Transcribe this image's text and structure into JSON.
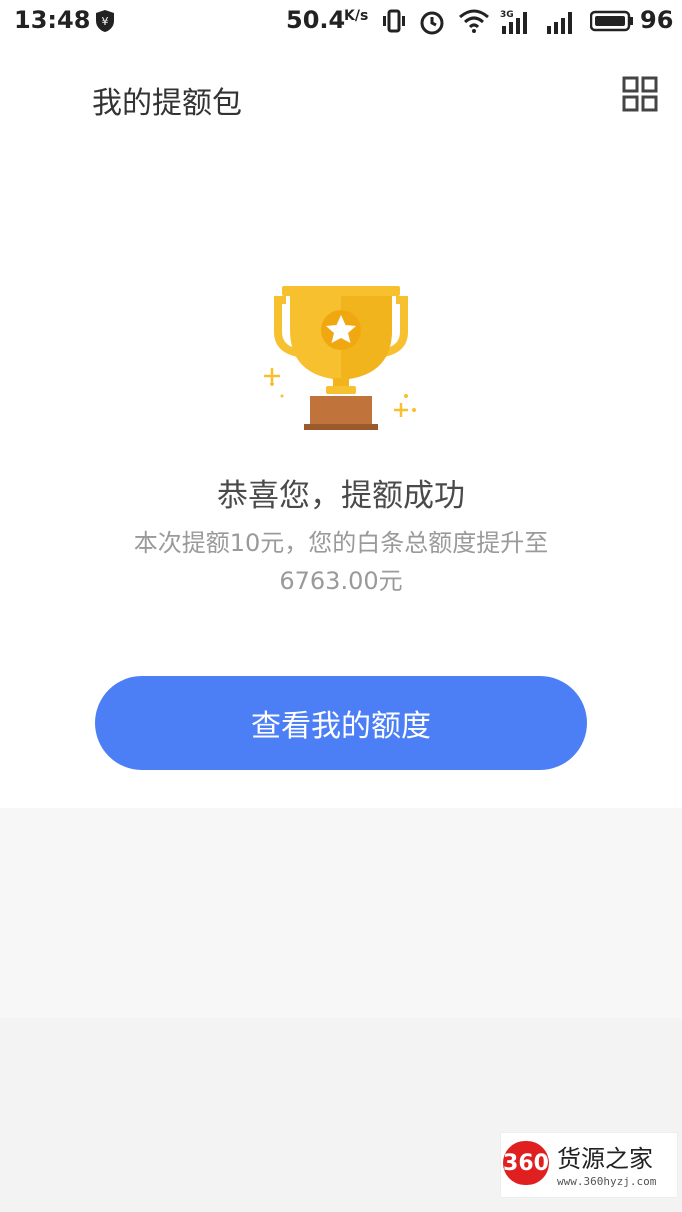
{
  "status_bar": {
    "time": "13:48",
    "net_speed": "50.4",
    "net_speed_unit": "K/s",
    "network_type": "3G",
    "battery": "96"
  },
  "header": {
    "title": "我的提额包"
  },
  "result": {
    "headline": "恭喜您，提额成功",
    "detail": "本次提额10元，您的白条总额度提升至6763.00元"
  },
  "actions": {
    "view_quota_label": "查看我的额度"
  },
  "watermark": {
    "badge": "360",
    "name": "货源之家",
    "url": "www.360hyzj.com"
  },
  "colors": {
    "accent": "#4c7ff5",
    "trophy_gold": "#f6c02f",
    "trophy_base": "#c0743b"
  }
}
